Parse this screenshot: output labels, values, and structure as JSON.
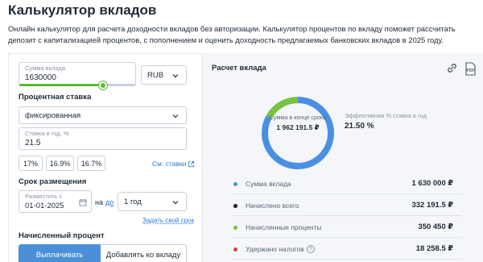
{
  "page": {
    "title": "Калькулятор вкладов",
    "description": "Онлайн калькулятор для расчета доходности вкладов без авторизации. Калькулятор процентов по вкладу поможет рассчитать депозит с капитализацией процентов, с пополнением и оценить доходность предлагаемых банковских вкладов в 2025 году."
  },
  "form": {
    "amount": {
      "label": "Сумма вклада",
      "value": "1630000",
      "slider_fraction": 0.72
    },
    "currency": {
      "value": "RUB"
    },
    "rate_section_label": "Процентная ставка",
    "rate_type": {
      "value": "фиксированная"
    },
    "rate": {
      "label": "Ставка в год, %",
      "value": "21.5"
    },
    "rate_chips": [
      "17%",
      "16.9%",
      "16.7%"
    ],
    "see_rates_link": "См. ставки",
    "term_section_label": "Срок размещения",
    "start_date": {
      "label": "Разместить с",
      "value": "01-01-2025"
    },
    "on_text": "на",
    "to_link": "до",
    "term": {
      "value": "1 год"
    },
    "set_period_link": "Задать свой срок",
    "interest_section_label": "Начисленный процент",
    "payout_button": "Выплачивать",
    "add_to_deposit_button": "Добавлять ко вкладу"
  },
  "result": {
    "title": "Расчет вклада",
    "donut_label": "Сумма в конце срока",
    "donut_value": "1 962 191.5 ₽",
    "effective_rate_label": "Эффективная % ставка в год",
    "effective_rate_value": "21.50 %",
    "rows": [
      {
        "label": "Сумма вклада",
        "value": "1 630 000 ₽",
        "color": "#4a90e2"
      },
      {
        "label": "Начислено всего",
        "value": "332 191.5 ₽",
        "color": "#111111"
      },
      {
        "label": "Начисленные проценты",
        "value": "350 450 ₽",
        "color": "#7ac142"
      },
      {
        "label": "Удержано налогов",
        "value": "18 258.5 ₽",
        "color": "#e53935"
      }
    ]
  },
  "chart_data": {
    "type": "pie",
    "categories": [
      "Сумма вклада",
      "Начисленные проценты"
    ],
    "values": [
      1630000,
      332191.5
    ],
    "colors": [
      "#4a90e2",
      "#7ac142"
    ]
  },
  "icons": {
    "chevron": "chevron-down-icon",
    "calendar": "calendar-icon",
    "external": "external-link-icon",
    "link": "link-icon",
    "pdf": "pdf-icon",
    "question": "question-icon"
  }
}
